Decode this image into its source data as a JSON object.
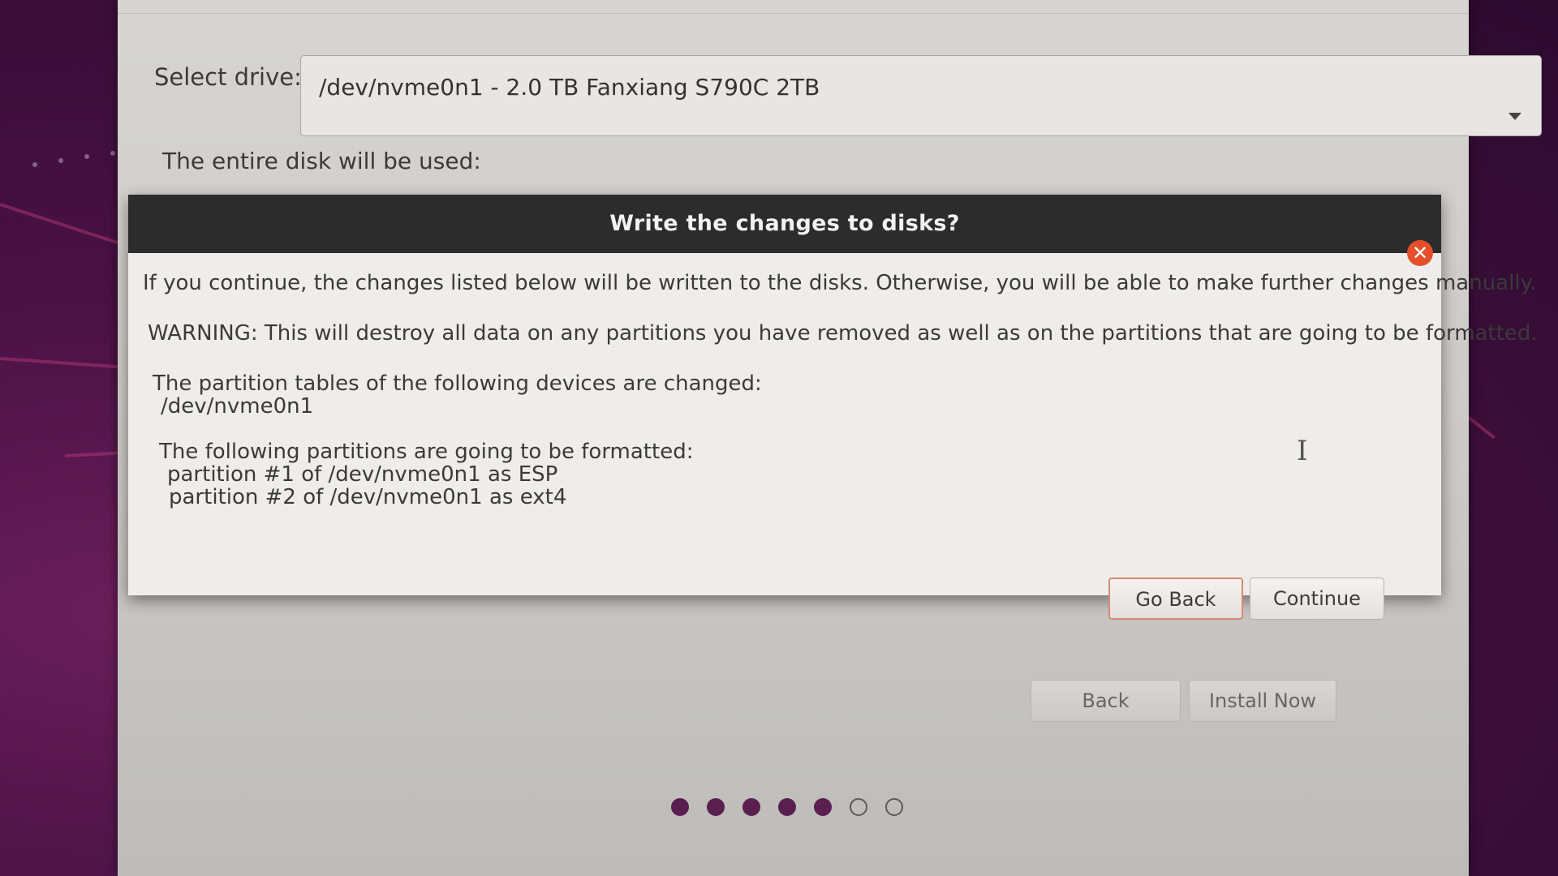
{
  "installer": {
    "select_drive_label": "Select drive:",
    "drive_value": "/dev/nvme0n1 - 2.0 TB Fanxiang S790C 2TB",
    "disk_usage_label": "The entire disk will be used:",
    "back_label": "Back",
    "install_now_label": "Install Now"
  },
  "dialog": {
    "title": "Write the changes to disks?",
    "close_glyph": "✕",
    "line_1": "If you continue, the changes listed below will be written to the disks. Otherwise, you will be able to make further changes manually.",
    "warning": "WARNING: This will destroy all data on any partitions you have removed as well as on the partitions that are going to be formatted.",
    "tables_heading": "The partition tables of the following devices are changed:",
    "tables_device": "/dev/nvme0n1",
    "format_heading": "The following partitions are going to be formatted:",
    "format_items": [
      "partition #1 of /dev/nvme0n1 as ESP",
      "partition #2 of /dev/nvme0n1 as ext4"
    ],
    "go_back_label": "Go Back",
    "continue_label": "Continue"
  },
  "progress": {
    "total_steps": 7,
    "completed_steps": 5
  },
  "icons": {
    "close": "close-icon",
    "dropdown": "chevron-down-icon",
    "text_cursor": "text-cursor-icon"
  },
  "colors": {
    "dialog_header": "#2c2c2c",
    "close_button": "#e5502b",
    "progress_filled": "#5b1f4f",
    "go_back_border": "#d88a72"
  }
}
